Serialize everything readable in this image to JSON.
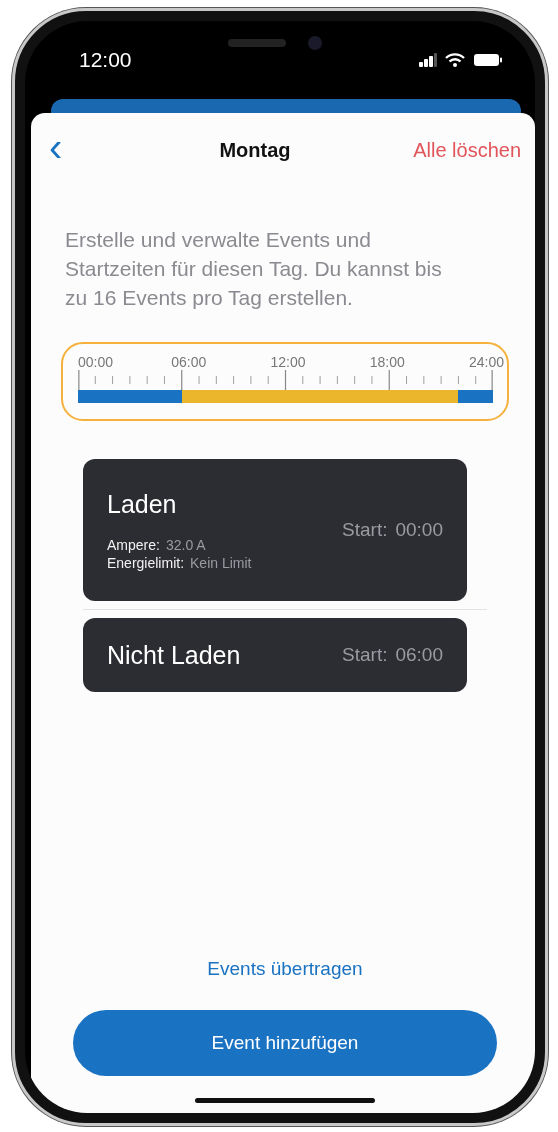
{
  "status_bar": {
    "time": "12:00"
  },
  "nav": {
    "back": "‹",
    "title": "Montag",
    "action": "Alle löschen"
  },
  "description": "Erstelle und verwalte Events und Startzeiten für diesen Tag. Du kannst bis zu 16 Events pro Tag erstellen.",
  "timeline": {
    "labels": [
      "00:00",
      "06:00",
      "12:00",
      "18:00",
      "24:00"
    ],
    "segments": [
      {
        "level": 0.25,
        "color": "#1a72c2"
      },
      {
        "level": 0.9167,
        "color": "#ebb52c"
      }
    ]
  },
  "events": [
    {
      "kind": "charge",
      "title": "Laden",
      "start_label": "Start:",
      "start": "00:00",
      "details": [
        {
          "label": "Ampere:",
          "value": "32.0 A"
        },
        {
          "label": "Energielimit:",
          "value": "Kein Limit"
        }
      ]
    },
    {
      "kind": "idle",
      "title": "Nicht Laden",
      "start_label": "Start:",
      "start": "06:00"
    }
  ],
  "transfer_link": "Events übertragen",
  "add_button": "Event hinzufügen"
}
